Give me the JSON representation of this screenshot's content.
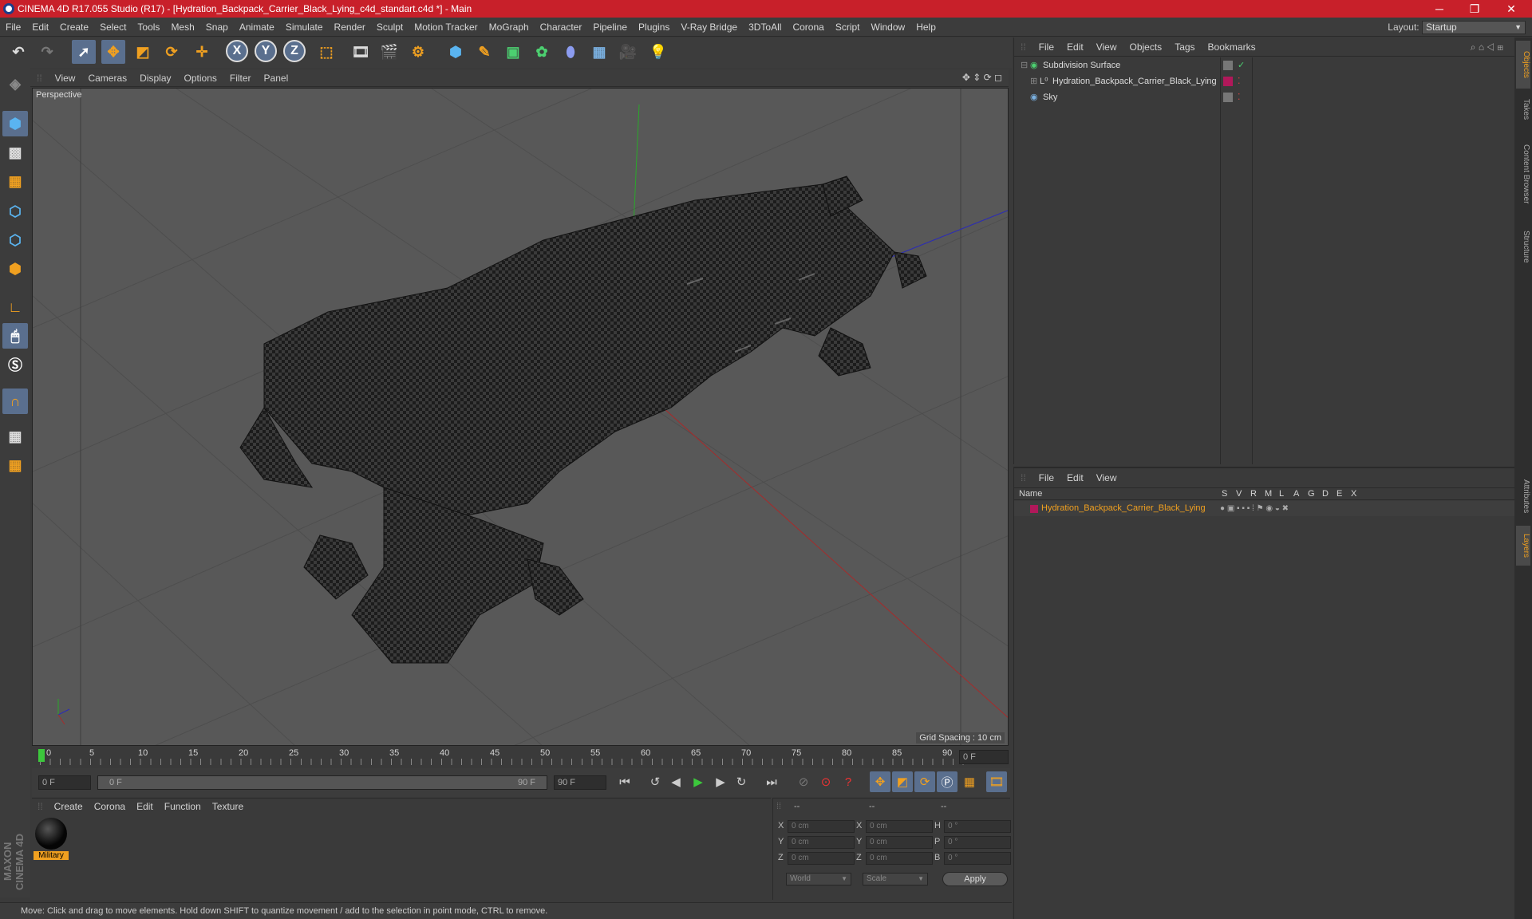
{
  "window": {
    "title": "CINEMA 4D R17.055 Studio (R17) - [Hydration_Backpack_Carrier_Black_Lying_c4d_standart.c4d *] - Main",
    "minimize": "─",
    "maximize": "❐",
    "close": "✕"
  },
  "menubar": {
    "items": [
      "File",
      "Edit",
      "Create",
      "Select",
      "Tools",
      "Mesh",
      "Snap",
      "Animate",
      "Simulate",
      "Render",
      "Sculpt",
      "Motion Tracker",
      "MoGraph",
      "Character",
      "Pipeline",
      "Plugins",
      "V-Ray Bridge",
      "3DToAll",
      "Corona",
      "Script",
      "Window",
      "Help"
    ],
    "layout_label": "Layout:",
    "layout_value": "Startup"
  },
  "toolbar": {
    "x": "X",
    "y": "Y",
    "z": "Z"
  },
  "viewport": {
    "menu": [
      "View",
      "Cameras",
      "Display",
      "Options",
      "Filter",
      "Panel"
    ],
    "label": "Perspective",
    "grid_spacing": "Grid Spacing : 10 cm"
  },
  "timeline": {
    "ticks": [
      "0",
      "5",
      "10",
      "15",
      "20",
      "25",
      "30",
      "35",
      "40",
      "45",
      "50",
      "55",
      "60",
      "65",
      "70",
      "75",
      "80",
      "85",
      "90"
    ],
    "current": "0 F"
  },
  "transport": {
    "start": "0 F",
    "range_start": "0 F",
    "range_end": "90 F",
    "end": "90 F"
  },
  "material_manager": {
    "menu": [
      "Create",
      "Corona",
      "Edit",
      "Function",
      "Texture"
    ],
    "material_name": "Military"
  },
  "coordinates": {
    "header": [
      "--",
      "--",
      "--"
    ],
    "rows": [
      {
        "a": "X",
        "v1": "0 cm",
        "b": "X",
        "v2": "0 cm",
        "c": "H",
        "v3": "0 °"
      },
      {
        "a": "Y",
        "v1": "0 cm",
        "b": "Y",
        "v2": "0 cm",
        "c": "P",
        "v3": "0 °"
      },
      {
        "a": "Z",
        "v1": "0 cm",
        "b": "Z",
        "v2": "0 cm",
        "c": "B",
        "v3": "0 °"
      }
    ],
    "world": "World",
    "scale": "Scale",
    "apply": "Apply"
  },
  "object_manager": {
    "menu": [
      "File",
      "Edit",
      "View",
      "Objects",
      "Tags",
      "Bookmarks"
    ],
    "objects": [
      "Subdivision Surface",
      "Hydration_Backpack_Carrier_Black_Lying",
      "Sky"
    ]
  },
  "layer_manager": {
    "menu": [
      "File",
      "Edit",
      "View"
    ],
    "name_header": "Name",
    "cols": [
      "S",
      "V",
      "R",
      "M",
      "L",
      "A",
      "G",
      "D",
      "E",
      "X"
    ],
    "layer": "Hydration_Backpack_Carrier_Black_Lying"
  },
  "right_tabs": [
    "Objects",
    "Takes",
    "Content Browser",
    "Structure",
    "Attributes",
    "Layers"
  ],
  "status": "Move: Click and drag to move elements. Hold down SHIFT to quantize movement / add to the selection in point mode, CTRL to remove.",
  "brand": "MAXON CINEMA 4D",
  "colors": {
    "accent": "#f0a020",
    "selection": "#5a6f8e",
    "title": "#c8202a"
  }
}
